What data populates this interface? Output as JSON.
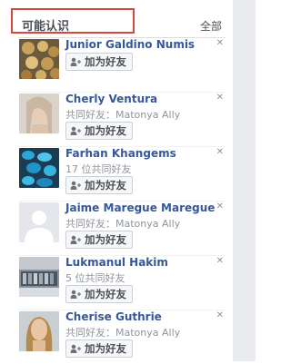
{
  "header": {
    "title": "可能认识",
    "see_all": "全部"
  },
  "add_button_label": "加为好友",
  "people": [
    {
      "name": "Junior Galdino Numis",
      "mutual": ""
    },
    {
      "name": "Cherly Ventura",
      "mutual": "共同好友：Matonya Ally"
    },
    {
      "name": "Farhan Khangems",
      "mutual": "17 位共同好友"
    },
    {
      "name": "Jaime Maregue Maregue",
      "mutual": "共同好友：Matonya Ally"
    },
    {
      "name": "Lukmanul Hakim",
      "mutual": "5 位共同好友"
    },
    {
      "name": "Cherise Guthrie",
      "mutual": "共同好友：Matonya Ally"
    }
  ],
  "icons": {
    "add": "add-friend-icon",
    "close": "close-icon"
  },
  "colors": {
    "name_link": "#365899",
    "highlight": "#d9453a"
  }
}
